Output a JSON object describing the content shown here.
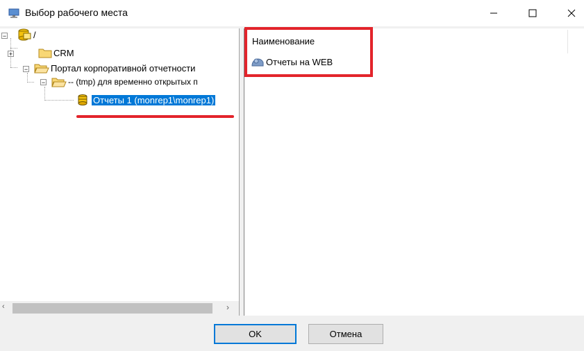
{
  "window": {
    "title": "Выбор рабочего места",
    "controls": {
      "minimize": "—",
      "maximize": "☐",
      "close": "✕"
    }
  },
  "tree": {
    "nodes": [
      {
        "label": "/",
        "icon": "database-root-icon",
        "expander": "minus"
      },
      {
        "label": "CRM",
        "icon": "folder-icon",
        "expander": "plus"
      },
      {
        "label": "Портал корпоративной отчетности",
        "icon": "folder-open-icon",
        "expander": "minus"
      },
      {
        "label": "-- (tmp) для временно открытых п",
        "icon": "folder-open-icon",
        "expander": "minus"
      },
      {
        "label": "Отчеты 1 (monrep1\\monrep1)",
        "icon": "database-icon",
        "selected": true
      }
    ],
    "scroll": {
      "left": "‹",
      "right": "›"
    }
  },
  "list": {
    "column_header": "Наименование",
    "items": [
      {
        "label": "Отчеты на WEB",
        "icon": "web-reports-icon"
      }
    ]
  },
  "buttons": {
    "ok": "OK",
    "cancel": "Отмена"
  },
  "colors": {
    "selection": "#0078d7",
    "annotation": "#e3242b"
  }
}
